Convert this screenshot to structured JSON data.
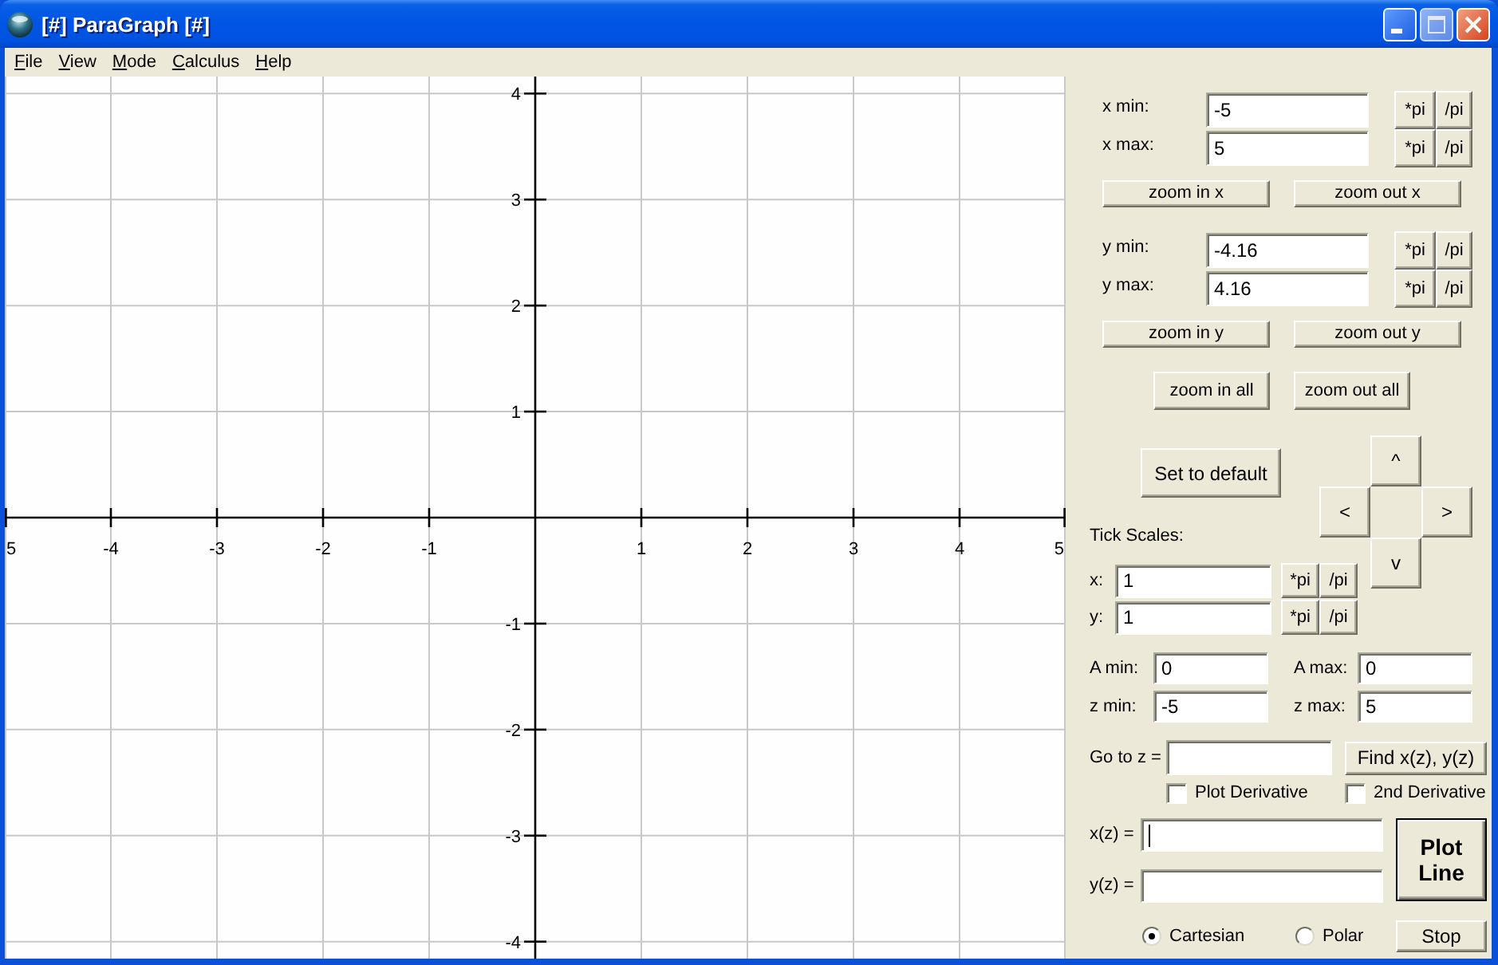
{
  "window": {
    "title": "[#] ParaGraph [#]"
  },
  "menu": [
    "File",
    "View",
    "Mode",
    "Calculus",
    "Help"
  ],
  "plot": {
    "chart_data": {
      "type": "line",
      "grid": true,
      "xlim": [
        -5,
        5
      ],
      "ylim": [
        -4.16,
        4.16
      ],
      "xticks": [
        {
          "value": -5,
          "label": "5"
        },
        -4,
        -3,
        -2,
        -1,
        1,
        2,
        3,
        4,
        {
          "value": 5,
          "label": "5"
        }
      ],
      "yticks": [
        -4,
        -3,
        -2,
        -1,
        1,
        2,
        3,
        4
      ]
    }
  },
  "x_range": {
    "rows": [
      {
        "label": "x min:",
        "value": "-5",
        "buttons": [
          "*pi",
          "/pi"
        ]
      },
      {
        "label": "x max:",
        "value": "5",
        "buttons": [
          "*pi",
          "/pi"
        ]
      }
    ],
    "zoom_buttons": [
      "zoom in x",
      "zoom out x"
    ]
  },
  "y_range": {
    "rows": [
      {
        "label": "y min:",
        "value": "-4.16",
        "buttons": [
          "*pi",
          "/pi"
        ]
      },
      {
        "label": "y max:",
        "value": "4.16",
        "buttons": [
          "*pi",
          "/pi"
        ]
      }
    ],
    "zoom_buttons": [
      "zoom in y",
      "zoom out y"
    ]
  },
  "zoom_all_buttons": [
    "zoom in all",
    "zoom out all"
  ],
  "set_default_button": "Set to default",
  "pan_buttons": {
    "up": "^",
    "left": "<",
    "right": ">",
    "down": "v"
  },
  "tick_scales": {
    "title": "Tick Scales:",
    "rows": [
      {
        "label": "x:",
        "value": "1",
        "buttons": [
          "*pi",
          "/pi"
        ]
      },
      {
        "label": "y:",
        "value": "1",
        "buttons": [
          "*pi",
          "/pi"
        ]
      }
    ]
  },
  "parameter_limits": [
    {
      "label": "A min:",
      "value": "0"
    },
    {
      "label": "A max:",
      "value": "0"
    },
    {
      "label": "z min:",
      "value": "-5"
    },
    {
      "label": "z max:",
      "value": "5"
    }
  ],
  "go_to": {
    "label": "Go to z =",
    "button": "Find x(z), y(z)"
  },
  "derivatives": [
    {
      "label": "Plot Derivative",
      "checked": false
    },
    {
      "label": "2nd Derivative",
      "checked": false
    }
  ],
  "functions": [
    {
      "label": "x(z) =",
      "focused": true
    },
    {
      "label": "y(z) =",
      "focused": false
    }
  ],
  "plot_button": "Plot Line",
  "coordinates": [
    {
      "label": "Cartesian",
      "selected": true
    },
    {
      "label": "Polar",
      "selected": false
    }
  ],
  "stop_button": "Stop"
}
